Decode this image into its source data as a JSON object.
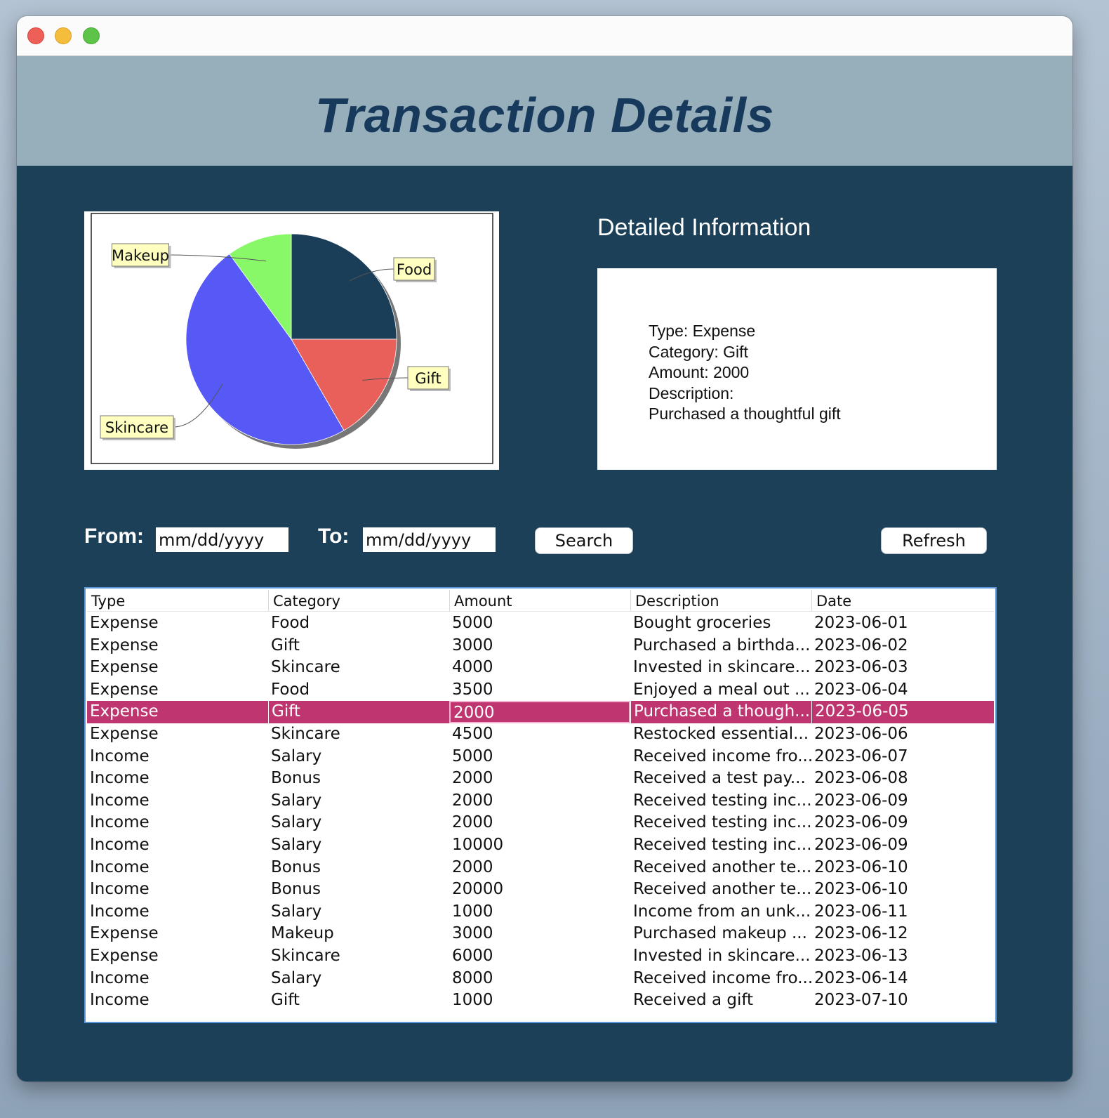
{
  "window": {
    "controls": [
      "close",
      "minimize",
      "maximize"
    ]
  },
  "header": {
    "title": "Transaction Details",
    "background": "#97aebb",
    "title_color": "#173a5c"
  },
  "chart_data": {
    "type": "pie",
    "labels": [
      "Food",
      "Gift",
      "Skincare",
      "Makeup"
    ],
    "values": [
      7500,
      5000,
      14500,
      3000
    ],
    "colors": [
      "#1a3d58",
      "#e9605a",
      "#5659f5",
      "#88f768"
    ],
    "legend": "callout labels"
  },
  "details": {
    "heading": "Detailed Information",
    "type_line": "Type: Expense",
    "category_line": "Category: Gift",
    "amount_line": "Amount: 2000",
    "description_label": "Description:",
    "description_value": "Purchased a thoughtful gift"
  },
  "filters": {
    "from_label": "From:",
    "from_value": "mm/dd/yyyy",
    "to_label": "To:",
    "to_value": "mm/dd/yyyy",
    "search_label": "Search",
    "refresh_label": "Refresh"
  },
  "table": {
    "columns": [
      "Type",
      "Category",
      "Amount",
      "Description",
      "Date"
    ],
    "selected_row": 4,
    "selected_color": "#bf3570",
    "rows": [
      [
        "Expense",
        "Food",
        "5000",
        "Bought groceries",
        "2023-06-01"
      ],
      [
        "Expense",
        "Gift",
        "3000",
        "Purchased a birthda...",
        "2023-06-02"
      ],
      [
        "Expense",
        "Skincare",
        "4000",
        "Invested in skincare...",
        "2023-06-03"
      ],
      [
        "Expense",
        "Food",
        "3500",
        "Enjoyed a meal out ...",
        "2023-06-04"
      ],
      [
        "Expense",
        "Gift",
        "2000",
        "Purchased a though...",
        "2023-06-05"
      ],
      [
        "Expense",
        "Skincare",
        "4500",
        "Restocked essential...",
        "2023-06-06"
      ],
      [
        "Income",
        "Salary",
        "5000",
        "Received income fro...",
        "2023-06-07"
      ],
      [
        "Income",
        "Bonus",
        "2000",
        "Received a test pay...",
        "2023-06-08"
      ],
      [
        "Income",
        "Salary",
        "2000",
        "Received testing inc...",
        "2023-06-09"
      ],
      [
        "Income",
        "Salary",
        "2000",
        "Received testing inc...",
        "2023-06-09"
      ],
      [
        "Income",
        "Salary",
        "10000",
        "Received testing inc...",
        "2023-06-09"
      ],
      [
        "Income",
        "Bonus",
        "2000",
        "Received another te...",
        "2023-06-10"
      ],
      [
        "Income",
        "Bonus",
        "20000",
        "Received another te...",
        "2023-06-10"
      ],
      [
        "Income",
        "Salary",
        "1000",
        "Income from an unk...",
        "2023-06-11"
      ],
      [
        "Expense",
        "Makeup",
        "3000",
        "Purchased makeup ...",
        "2023-06-12"
      ],
      [
        "Expense",
        "Skincare",
        "6000",
        "Invested in skincare...",
        "2023-06-13"
      ],
      [
        "Income",
        "Salary",
        "8000",
        "Received income fro...",
        "2023-06-14"
      ],
      [
        "Income",
        "Gift",
        "1000",
        "Received a gift",
        "2023-07-10"
      ]
    ]
  }
}
